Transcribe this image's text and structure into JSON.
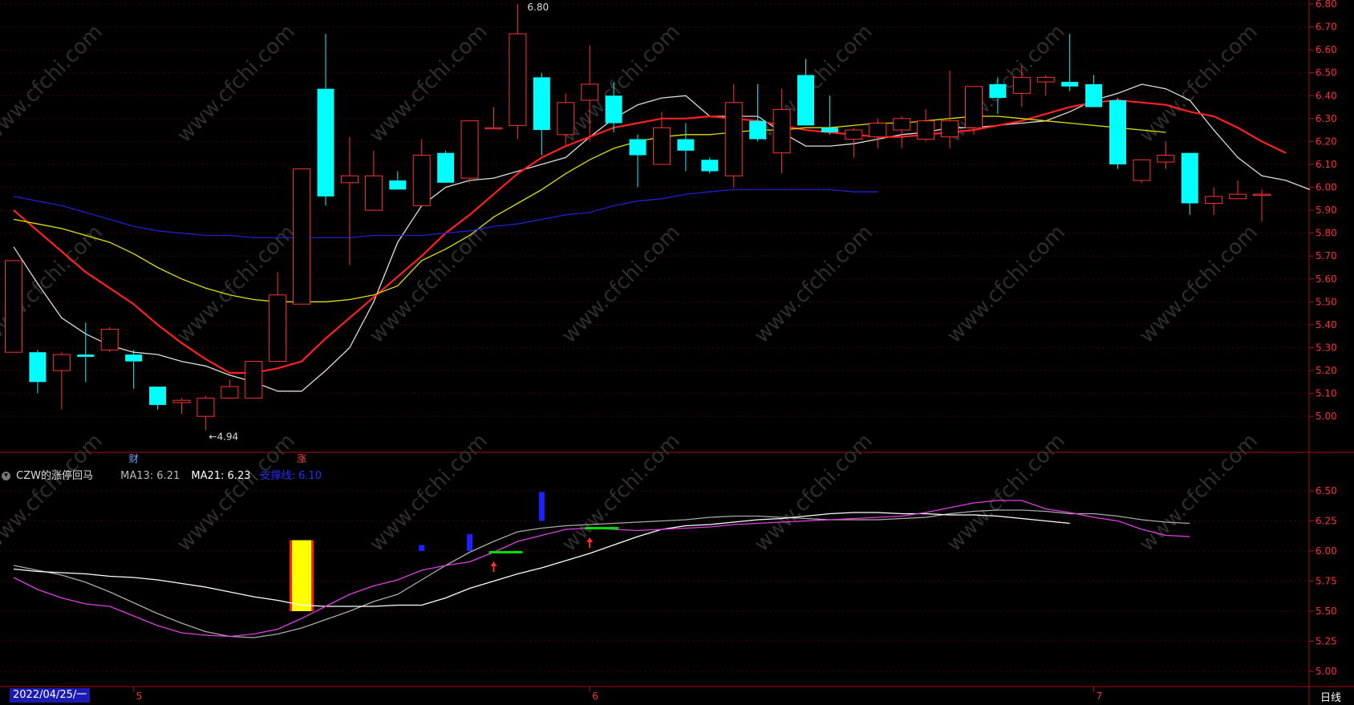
{
  "chart_data": [
    {
      "name": "main",
      "type": "candlestick",
      "ylim": [
        4.85,
        6.8
      ],
      "yticks": [
        "6.80",
        "6.70",
        "6.60",
        "6.50",
        "6.40",
        "6.30",
        "6.20",
        "6.10",
        "6.00",
        "5.90",
        "5.80",
        "5.70",
        "5.60",
        "5.50",
        "5.40",
        "5.30",
        "5.20",
        "5.10",
        "5.00"
      ],
      "candles": [
        {
          "o": 5.28,
          "h": 5.68,
          "l": 5.28,
          "c": 5.68
        },
        {
          "o": 5.28,
          "h": 5.29,
          "l": 5.1,
          "c": 5.15
        },
        {
          "o": 5.2,
          "h": 5.28,
          "l": 5.03,
          "c": 5.27
        },
        {
          "o": 5.27,
          "h": 5.41,
          "l": 5.15,
          "c": 5.26
        },
        {
          "o": 5.29,
          "h": 5.39,
          "l": 5.28,
          "c": 5.38
        },
        {
          "o": 5.27,
          "h": 5.29,
          "l": 5.12,
          "c": 5.24
        },
        {
          "o": 5.13,
          "h": 5.13,
          "l": 5.03,
          "c": 5.05
        },
        {
          "o": 5.06,
          "h": 5.08,
          "l": 5.01,
          "c": 5.07
        },
        {
          "o": 5.0,
          "h": 5.09,
          "l": 4.94,
          "c": 5.08
        },
        {
          "o": 5.08,
          "h": 5.16,
          "l": 5.08,
          "c": 5.13
        },
        {
          "o": 5.08,
          "h": 5.24,
          "l": 5.08,
          "c": 5.24
        },
        {
          "o": 5.24,
          "h": 5.63,
          "l": 5.24,
          "c": 5.53
        },
        {
          "o": 5.49,
          "h": 6.08,
          "l": 5.49,
          "c": 6.08
        },
        {
          "o": 6.43,
          "h": 6.67,
          "l": 5.92,
          "c": 5.96
        },
        {
          "o": 6.02,
          "h": 6.22,
          "l": 5.66,
          "c": 6.05
        },
        {
          "o": 5.9,
          "h": 6.16,
          "l": 5.9,
          "c": 6.05
        },
        {
          "o": 6.03,
          "h": 6.07,
          "l": 5.99,
          "c": 5.99
        },
        {
          "o": 5.92,
          "h": 6.21,
          "l": 5.92,
          "c": 6.14
        },
        {
          "o": 6.15,
          "h": 6.16,
          "l": 6.03,
          "c": 6.02
        },
        {
          "o": 6.04,
          "h": 6.29,
          "l": 6.02,
          "c": 6.29
        },
        {
          "o": 6.26,
          "h": 6.35,
          "l": 6.26,
          "c": 6.26
        },
        {
          "o": 6.27,
          "h": 6.8,
          "l": 6.21,
          "c": 6.67
        },
        {
          "o": 6.48,
          "h": 6.5,
          "l": 6.14,
          "c": 6.25
        },
        {
          "o": 6.23,
          "h": 6.41,
          "l": 6.18,
          "c": 6.37
        },
        {
          "o": 6.38,
          "h": 6.62,
          "l": 6.2,
          "c": 6.45
        },
        {
          "o": 6.4,
          "h": 6.46,
          "l": 6.24,
          "c": 6.28
        },
        {
          "o": 6.21,
          "h": 6.23,
          "l": 6.0,
          "c": 6.14
        },
        {
          "o": 6.1,
          "h": 6.33,
          "l": 6.1,
          "c": 6.26
        },
        {
          "o": 6.21,
          "h": 6.28,
          "l": 6.07,
          "c": 6.16
        },
        {
          "o": 6.12,
          "h": 6.13,
          "l": 6.06,
          "c": 6.07
        },
        {
          "o": 6.05,
          "h": 6.45,
          "l": 6.0,
          "c": 6.37
        },
        {
          "o": 6.29,
          "h": 6.45,
          "l": 6.2,
          "c": 6.21
        },
        {
          "o": 6.15,
          "h": 6.43,
          "l": 6.06,
          "c": 6.34
        },
        {
          "o": 6.49,
          "h": 6.56,
          "l": 6.27,
          "c": 6.27
        },
        {
          "o": 6.26,
          "h": 6.4,
          "l": 6.23,
          "c": 6.24
        },
        {
          "o": 6.21,
          "h": 6.26,
          "l": 6.13,
          "c": 6.25
        },
        {
          "o": 6.22,
          "h": 6.3,
          "l": 6.17,
          "c": 6.28
        },
        {
          "o": 6.25,
          "h": 6.31,
          "l": 6.17,
          "c": 6.3
        },
        {
          "o": 6.21,
          "h": 6.34,
          "l": 6.2,
          "c": 6.29
        },
        {
          "o": 6.22,
          "h": 6.51,
          "l": 6.17,
          "c": 6.29
        },
        {
          "o": 6.26,
          "h": 6.37,
          "l": 6.23,
          "c": 6.44
        },
        {
          "o": 6.45,
          "h": 6.48,
          "l": 6.32,
          "c": 6.39
        },
        {
          "o": 6.41,
          "h": 6.53,
          "l": 6.35,
          "c": 6.48
        },
        {
          "o": 6.46,
          "h": 6.49,
          "l": 6.4,
          "c": 6.48
        },
        {
          "o": 6.46,
          "h": 6.67,
          "l": 6.42,
          "c": 6.44
        },
        {
          "o": 6.45,
          "h": 6.49,
          "l": 6.35,
          "c": 6.35
        },
        {
          "o": 6.38,
          "h": 6.39,
          "l": 6.08,
          "c": 6.1
        },
        {
          "o": 6.03,
          "h": 6.12,
          "l": 6.02,
          "c": 6.12
        },
        {
          "o": 6.11,
          "h": 6.2,
          "l": 6.08,
          "c": 6.14
        },
        {
          "o": 6.15,
          "h": 6.15,
          "l": 5.88,
          "c": 5.93
        },
        {
          "o": 5.93,
          "h": 6.0,
          "l": 5.88,
          "c": 5.96
        },
        {
          "o": 5.95,
          "h": 6.03,
          "l": 5.95,
          "c": 5.97
        },
        {
          "o": 5.97,
          "h": 5.99,
          "l": 5.85,
          "c": 5.97
        }
      ],
      "ma_lines": [
        {
          "color": "#dddddd",
          "values": [
            5.74,
            5.58,
            5.43,
            5.36,
            5.31,
            5.28,
            5.27,
            5.24,
            5.22,
            5.18,
            5.15,
            5.11,
            5.11,
            5.2,
            5.3,
            5.5,
            5.76,
            5.92,
            6.0,
            6.03,
            6.04,
            6.07,
            6.1,
            6.13,
            6.22,
            6.3,
            6.36,
            6.39,
            6.4,
            6.31,
            6.31,
            6.31,
            6.24,
            6.18,
            6.18,
            6.19,
            6.21,
            6.23,
            6.24,
            6.26,
            6.26,
            6.27,
            6.28,
            6.29,
            6.33,
            6.38,
            6.41,
            6.45,
            6.43,
            6.38,
            6.25,
            6.13,
            6.05,
            6.03,
            5.99
          ]
        },
        {
          "color": "#ff2020",
          "values": [
            5.9,
            5.81,
            5.72,
            5.63,
            5.56,
            5.49,
            5.4,
            5.32,
            5.25,
            5.19,
            5.19,
            5.21,
            5.24,
            5.34,
            5.43,
            5.52,
            5.61,
            5.7,
            5.8,
            5.88,
            5.97,
            6.06,
            6.13,
            6.18,
            6.22,
            6.26,
            6.28,
            6.3,
            6.3,
            6.31,
            6.3,
            6.29,
            6.27,
            6.25,
            6.24,
            6.23,
            6.22,
            6.22,
            6.23,
            6.24,
            6.25,
            6.27,
            6.29,
            6.32,
            6.35,
            6.37,
            6.38,
            6.37,
            6.36,
            6.33,
            6.31,
            6.26,
            6.2,
            6.15
          ]
        },
        {
          "color": "#e0e000",
          "values": [
            5.86,
            5.84,
            5.82,
            5.79,
            5.76,
            5.71,
            5.65,
            5.6,
            5.56,
            5.53,
            5.51,
            5.5,
            5.5,
            5.5,
            5.51,
            5.53,
            5.57,
            5.68,
            5.73,
            5.79,
            5.87,
            5.93,
            5.99,
            6.06,
            6.12,
            6.17,
            6.2,
            6.22,
            6.23,
            6.23,
            6.24,
            6.25,
            6.25,
            6.26,
            6.26,
            6.27,
            6.28,
            6.28,
            6.29,
            6.3,
            6.31,
            6.31,
            6.3,
            6.29,
            6.28,
            6.27,
            6.26,
            6.25,
            6.24
          ]
        },
        {
          "color": "#2020d0",
          "values": [
            5.96,
            5.94,
            5.92,
            5.89,
            5.86,
            5.83,
            5.81,
            5.8,
            5.79,
            5.79,
            5.78,
            5.78,
            5.78,
            5.78,
            5.78,
            5.79,
            5.79,
            5.79,
            5.8,
            5.81,
            5.83,
            5.84,
            5.86,
            5.88,
            5.89,
            5.92,
            5.94,
            5.95,
            5.97,
            5.98,
            5.99,
            5.99,
            5.99,
            5.99,
            5.99,
            5.98,
            5.98
          ]
        }
      ],
      "annotations": [
        {
          "label": "6.80",
          "candle": 21,
          "price": 6.8
        },
        {
          "label": "←4.94",
          "candle": 8,
          "price": 4.94
        }
      ],
      "markers": [
        {
          "label": "财",
          "candle": 5,
          "color": "#6fa8ff"
        },
        {
          "label": "涨",
          "candle": 12,
          "color": "#ff4040"
        }
      ]
    },
    {
      "name": "indicator",
      "type": "line",
      "ylim": [
        4.88,
        6.7
      ],
      "yticks": [
        "6.50",
        "6.25",
        "6.00",
        "5.75",
        "5.50",
        "5.25",
        "5.00"
      ],
      "title": "CZW的涨停回马",
      "legend": [
        {
          "text": "MA13: 6.21",
          "color": "#bbbbbb"
        },
        {
          "text": "MA21: 6.23",
          "color": "#ffffff"
        },
        {
          "text": "支撑线: 6.10",
          "color": "#2a2aff"
        }
      ],
      "series": [
        {
          "color": "#aaaaaa",
          "values": [
            5.88,
            5.84,
            5.8,
            5.74,
            5.66,
            5.57,
            5.48,
            5.4,
            5.33,
            5.29,
            5.28,
            5.31,
            5.36,
            5.43,
            5.5,
            5.58,
            5.64,
            5.76,
            5.88,
            5.99,
            6.08,
            6.16,
            6.19,
            6.21,
            6.22,
            6.23,
            6.24,
            6.25,
            6.26,
            6.28,
            6.29,
            6.29,
            6.28,
            6.27,
            6.26,
            6.26,
            6.26,
            6.27,
            6.28,
            6.31,
            6.33,
            6.34,
            6.34,
            6.33,
            6.31,
            6.31,
            6.29,
            6.26,
            6.24,
            6.23
          ]
        },
        {
          "color": "#ffffff",
          "values": [
            5.85,
            5.83,
            5.82,
            5.81,
            5.79,
            5.78,
            5.76,
            5.73,
            5.7,
            5.66,
            5.62,
            5.59,
            5.55,
            5.54,
            5.54,
            5.54,
            5.55,
            5.55,
            5.61,
            5.69,
            5.75,
            5.81,
            5.86,
            5.92,
            5.98,
            6.05,
            6.12,
            6.18,
            6.21,
            6.22,
            6.24,
            6.26,
            6.27,
            6.29,
            6.31,
            6.32,
            6.32,
            6.31,
            6.31,
            6.3,
            6.3,
            6.29,
            6.27,
            6.25,
            6.23
          ]
        },
        {
          "color": "#e040e0",
          "values": [
            5.78,
            5.68,
            5.61,
            5.56,
            5.54,
            5.46,
            5.38,
            5.32,
            5.3,
            5.29,
            5.31,
            5.35,
            5.44,
            5.54,
            5.64,
            5.71,
            5.76,
            5.84,
            5.88,
            5.91,
            5.99,
            6.08,
            6.13,
            6.18,
            6.19,
            6.18,
            6.17,
            6.18,
            6.19,
            6.2,
            6.22,
            6.23,
            6.24,
            6.25,
            6.26,
            6.27,
            6.28,
            6.29,
            6.32,
            6.36,
            6.4,
            6.42,
            6.42,
            6.35,
            6.32,
            6.28,
            6.25,
            6.18,
            6.13,
            6.12
          ]
        }
      ],
      "signal_bars": [
        {
          "candle": 12,
          "top": 6.09,
          "bottom": 5.5,
          "fill": "#ffff00",
          "border": "#ff2020"
        },
        {
          "candle": 17,
          "top": 6.05,
          "bottom": 6.0,
          "fill": "#2020ff"
        },
        {
          "candle": 19,
          "top": 6.14,
          "bottom": 6.0,
          "fill": "#2020ff"
        },
        {
          "candle": 22,
          "top": 6.49,
          "bottom": 6.25,
          "fill": "#2020ff"
        }
      ],
      "flat_marks": [
        {
          "from": 20,
          "to": 21,
          "value": 5.99,
          "color": "#00dd00"
        },
        {
          "from": 24,
          "to": 25,
          "value": 6.19,
          "color": "#00dd00"
        }
      ],
      "arrows": [
        {
          "candle": 20,
          "value": 5.9,
          "color": "#ff3030"
        },
        {
          "candle": 24,
          "value": 6.1,
          "color": "#ff3030"
        }
      ]
    }
  ],
  "xaxis": {
    "labels": [
      {
        "label": "5",
        "candle": 5
      },
      {
        "label": "6",
        "candle": 24
      },
      {
        "label": "7",
        "candle": 45
      }
    ],
    "date_box": "2022/04/25/一",
    "period": "日线"
  },
  "watermark": "www.cfchi.com"
}
